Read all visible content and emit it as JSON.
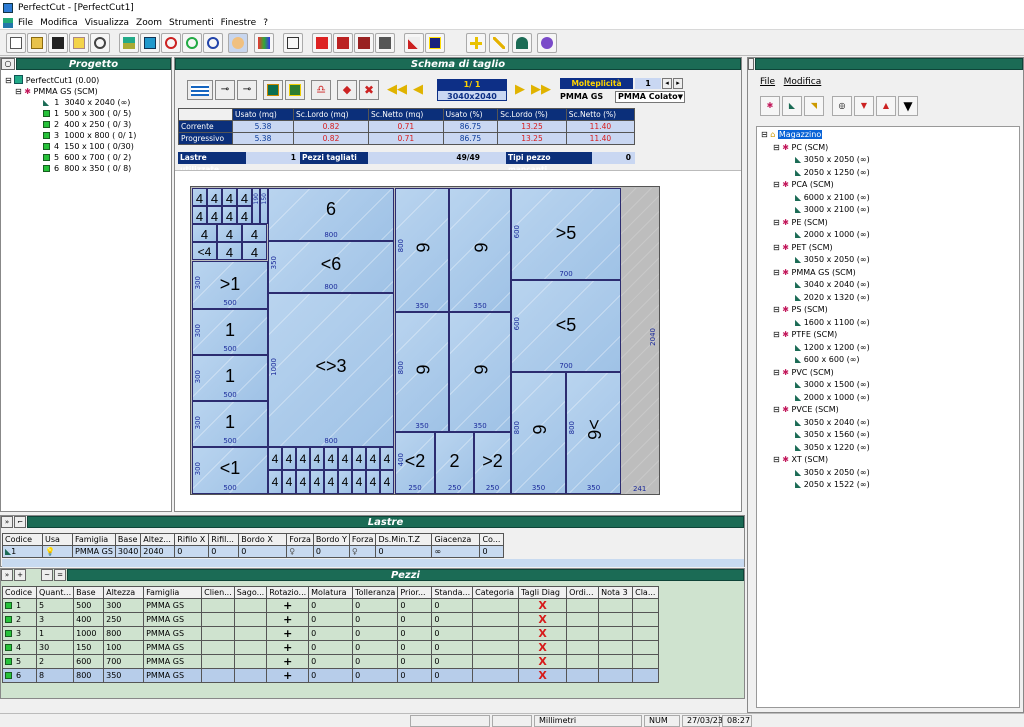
{
  "window": {
    "title": "PerfectCut - [PerfectCut1]"
  },
  "menu": [
    "File",
    "Modifica",
    "Visualizza",
    "Zoom",
    "Strumenti",
    "Finestre",
    "?"
  ],
  "progetto": {
    "title": "Progetto",
    "root": "PerfectCut1 (0.00)",
    "material": "PMMA GS (SCM)",
    "sheet": {
      "num": "1",
      "label": "3040 x 2040 (∞)"
    },
    "pieces": [
      {
        "num": "1",
        "label": "500 x 300  ( 0/ 5)"
      },
      {
        "num": "2",
        "label": "400 x 250  ( 0/ 3)"
      },
      {
        "num": "3",
        "label": "1000 x 800  ( 0/ 1)"
      },
      {
        "num": "4",
        "label": "150 x 100  ( 0/30)"
      },
      {
        "num": "5",
        "label": "600 x 700  ( 0/ 2)"
      },
      {
        "num": "6",
        "label": "800 x 350  ( 0/ 8)"
      }
    ]
  },
  "schema": {
    "title": "Schema di taglio",
    "counter": "1/  1",
    "sheet_size": "3040x2040",
    "molteplicita_label": "Molteplicità",
    "molteplicita_value": "1",
    "material_a": "PMMA GS",
    "material_b": "PMMA Colato",
    "headers": [
      "Usato (mq)",
      "Sc.Lordo (mq)",
      "Sc.Netto (mq)",
      "Usato (%)",
      "Sc.Lordo (%)",
      "Sc.Netto (%)"
    ],
    "rows": [
      {
        "label": "Corrente",
        "values": [
          "5.38",
          "0.82",
          "0.71",
          "86.75",
          "13.25",
          "11.40"
        ]
      },
      {
        "label": "Progressivo",
        "values": [
          "5.38",
          "0.82",
          "0.71",
          "86.75",
          "13.25",
          "11.40"
        ]
      }
    ],
    "lastre_label": "Lastre utilizzate",
    "lastre_value": "1",
    "pezzi_label": "Pezzi tagliati",
    "pezzi_value": "49/49",
    "tipi_label": "Tipi pezzo mancanti",
    "tipi_value": "0"
  },
  "layout_labels": {
    "p6top": "6",
    "p6top_dim": "800",
    "p6b": "<6",
    "p6b_dim": "800",
    "p1a": ">1",
    "p1a_dim": "500",
    "p1a_side": "300",
    "p1b": "1",
    "p1b_dim": "500",
    "p1b_side": "300",
    "p1c": "1",
    "p1c_dim": "500",
    "p1c_side": "300",
    "p1d": "1",
    "p1d_dim": "500",
    "p1d_side": "300",
    "p1e": "<1",
    "p1e_dim": "500",
    "p1e_side": "300",
    "p3": "<>3",
    "p3_dim": "800",
    "p3_side": "1000",
    "v6a": "6",
    "v6a_dim": "350",
    "v6a_side": "800",
    "v6b": "6",
    "v6b_dim": "350",
    "v6c": "6",
    "v6c_dim": "350",
    "v6c_side": "800",
    "v6d": "6",
    "v6d_dim": "350",
    "p5a": ">5",
    "p5a_dim": "700",
    "p5a_side": "600",
    "p5b": "<5",
    "p5b_dim": "700",
    "p5b_side": "600",
    "p6x": "6",
    "p6x_dim": "350",
    "p6x_side": "800",
    "p6y": ">6",
    "p6y_dim": "350",
    "p6y_side": "800",
    "p2a": "<2",
    "p2a_dim": "250",
    "p2a_side": "400",
    "p2b": "2",
    "p2b_dim": "250",
    "p2c": ">2",
    "p2c_dim": "250",
    "four": "4",
    "four_lt": "<4",
    "w1": "2040",
    "w2": "241",
    "s190": "190",
    "s350": "350",
    "s150": "150"
  },
  "lastre": {
    "title": "Lastre",
    "headers": [
      "Codice",
      "Usa",
      "Famiglia",
      "Base",
      "Altez...",
      "Rifilo X",
      "Rifil...",
      "Bordo X",
      "Forza",
      "Bordo Y",
      "Forza",
      "Ds.Min.T.Z",
      "Giacenza",
      "Co..."
    ],
    "row": [
      "1",
      "",
      "PMMA GS",
      "3040",
      "2040",
      "0",
      "0",
      "0",
      "",
      "0",
      "",
      "0",
      "∞",
      "0"
    ]
  },
  "pezzi": {
    "title": "Pezzi",
    "headers": [
      "Codice",
      "Quant...",
      "Base",
      "Altezza",
      "Famiglia",
      "Clien...",
      "Sago...",
      "Rotazio...",
      "Molatura",
      "Tolleranza",
      "Prior...",
      "Standa...",
      "Categoria",
      "Tagli Diag",
      "Ordi...",
      "Nota 3",
      "Cla..."
    ],
    "rows": [
      [
        "1",
        "5",
        "500",
        "300",
        "PMMA GS",
        "",
        "",
        "+",
        "0",
        "0",
        "0",
        "0",
        "",
        "X",
        "",
        "",
        ""
      ],
      [
        "2",
        "3",
        "400",
        "250",
        "PMMA GS",
        "",
        "",
        "+",
        "0",
        "0",
        "0",
        "0",
        "",
        "X",
        "",
        "",
        ""
      ],
      [
        "3",
        "1",
        "1000",
        "800",
        "PMMA GS",
        "",
        "",
        "+",
        "0",
        "0",
        "0",
        "0",
        "",
        "X",
        "",
        "",
        ""
      ],
      [
        "4",
        "30",
        "150",
        "100",
        "PMMA GS",
        "",
        "",
        "+",
        "0",
        "0",
        "0",
        "0",
        "",
        "X",
        "",
        "",
        ""
      ],
      [
        "5",
        "2",
        "600",
        "700",
        "PMMA GS",
        "",
        "",
        "+",
        "0",
        "0",
        "0",
        "0",
        "",
        "X",
        "",
        "",
        ""
      ],
      [
        "6",
        "8",
        "800",
        "350",
        "PMMA GS",
        "",
        "",
        "+",
        "0",
        "0",
        "0",
        "0",
        "",
        "X",
        "",
        "",
        ""
      ]
    ]
  },
  "magazzino": {
    "menu": [
      "File",
      "Modifica"
    ],
    "root": "Magazzino",
    "groups": [
      {
        "name": "PC (SCM)",
        "items": [
          "3050 x 2050 (∞)",
          "2050 x 1250 (∞)"
        ]
      },
      {
        "name": "PCA (SCM)",
        "items": [
          "6000 x 2100 (∞)",
          "3000 x 2100 (∞)"
        ]
      },
      {
        "name": "PE (SCM)",
        "items": [
          "2000 x 1000 (∞)"
        ]
      },
      {
        "name": "PET (SCM)",
        "items": [
          "3050 x 2050 (∞)"
        ]
      },
      {
        "name": "PMMA GS (SCM)",
        "items": [
          "3040 x 2040 (∞)",
          "2020 x 1320 (∞)"
        ]
      },
      {
        "name": "PS (SCM)",
        "items": [
          "1600 x 1100 (∞)"
        ]
      },
      {
        "name": "PTFE (SCM)",
        "items": [
          "1200 x 1200 (∞)",
          "600 x 600 (∞)"
        ]
      },
      {
        "name": "PVC (SCM)",
        "items": [
          "3000 x 1500 (∞)",
          "2000 x 1000 (∞)"
        ]
      },
      {
        "name": "PVCE (SCM)",
        "items": [
          "3050 x 2040 (∞)",
          "3050 x 1560 (∞)",
          "3050 x 1220 (∞)"
        ]
      },
      {
        "name": "XT (SCM)",
        "items": [
          "3050 x 2050 (∞)",
          "2050 x 1522 (∞)"
        ]
      }
    ]
  },
  "status": {
    "unit": "Millimetri",
    "num": "NUM",
    "date": "27/03/23",
    "time": "08:27"
  },
  "colors": {
    "panel_green": "#1b6b55",
    "stat_blue": "#0b2f7a",
    "piece_blue": "#a9cbed",
    "accent_green": "#27c23a"
  }
}
